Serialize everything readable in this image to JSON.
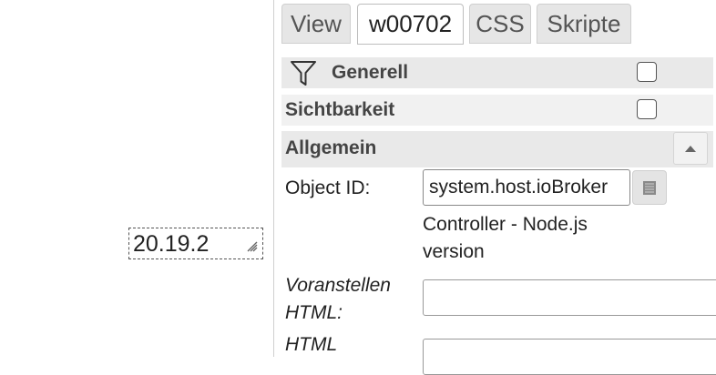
{
  "widget": {
    "value": "20.19.2"
  },
  "tabs": [
    {
      "label": "View",
      "active": false
    },
    {
      "label": "w00702",
      "active": true
    },
    {
      "label": "CSS",
      "active": false
    },
    {
      "label": "Skripte",
      "active": false
    }
  ],
  "groups": {
    "generell": {
      "label": "Generell",
      "icon": "filter-icon",
      "checked": false
    },
    "sichtbarkeit": {
      "label": "Sichtbarkeit",
      "checked": false
    },
    "allgemein": {
      "label": "Allgemein",
      "collapse_icon": "chevron-up-icon"
    }
  },
  "fields": {
    "object_id": {
      "label": "Object ID:",
      "value": "system.host.ioBroker",
      "description": "Controller - Node.js version",
      "picker_icon": "list-icon"
    },
    "voranstellen_html": {
      "label_line1": "Voranstellen",
      "label_line2": "HTML:",
      "value": ""
    },
    "html": {
      "label_line1": "HTML",
      "value": ""
    }
  },
  "colors": {
    "header_bg": "#e9e9e9",
    "tab_inactive_bg": "#e6e6e6",
    "tab_active_bg": "#ffffff"
  }
}
